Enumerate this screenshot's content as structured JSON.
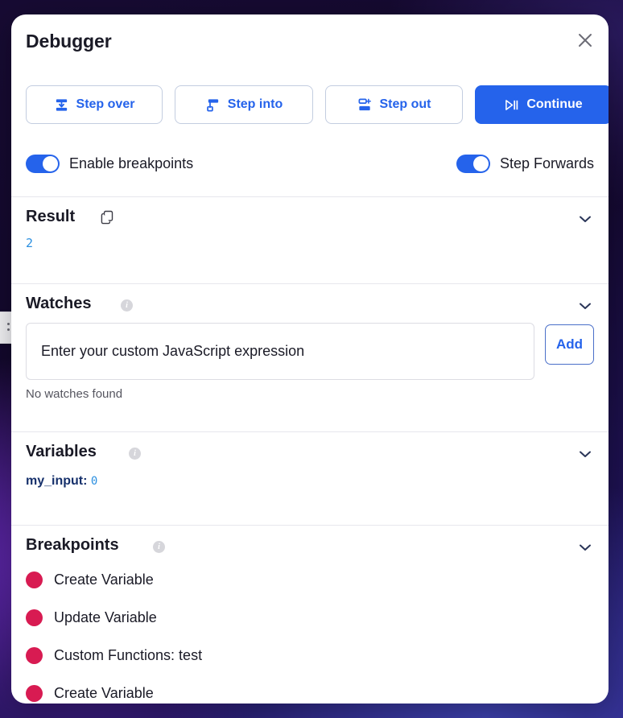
{
  "panel": {
    "title": "Debugger",
    "close_icon": "close-icon"
  },
  "controls": {
    "buttons": [
      {
        "label": "Step over",
        "icon": "step-over-icon",
        "style": "outline"
      },
      {
        "label": "Step into",
        "icon": "step-into-icon",
        "style": "outline"
      },
      {
        "label": "Step out",
        "icon": "step-out-icon",
        "style": "outline"
      },
      {
        "label": "Continue",
        "icon": "play-pause-icon",
        "style": "primary"
      }
    ],
    "toggles": [
      {
        "label": "Enable breakpoints",
        "on": true
      },
      {
        "label": "Step Forwards",
        "on": true
      }
    ]
  },
  "sections": {
    "result": {
      "title": "Result",
      "copy_icon": "copy-icon",
      "chevron_icon": "chevron-down-icon",
      "value": "2"
    },
    "watches": {
      "title": "Watches",
      "info_icon": "info-icon",
      "chevron_icon": "chevron-down-icon",
      "input_placeholder": "Enter your custom JavaScript expression",
      "input_value": "",
      "add_label": "Add",
      "empty_text": "No watches found"
    },
    "variables": {
      "title": "Variables",
      "info_icon": "info-icon",
      "chevron_icon": "chevron-down-icon",
      "items": [
        {
          "name": "my_input",
          "separator": ":",
          "value": "0"
        }
      ]
    },
    "breakpoints": {
      "title": "Breakpoints",
      "info_icon": "info-icon",
      "chevron_icon": "chevron-down-icon",
      "items": [
        {
          "label": "Create Variable"
        },
        {
          "label": "Update Variable"
        },
        {
          "label": "Custom Functions: test"
        },
        {
          "label": "Create Variable"
        }
      ]
    }
  },
  "colors": {
    "accent": "#2563eb",
    "value_blue": "#2b8fe0",
    "breakpoint_dot": "#d81b52",
    "title_dark": "#1a1a26",
    "var_name": "#16306b"
  }
}
